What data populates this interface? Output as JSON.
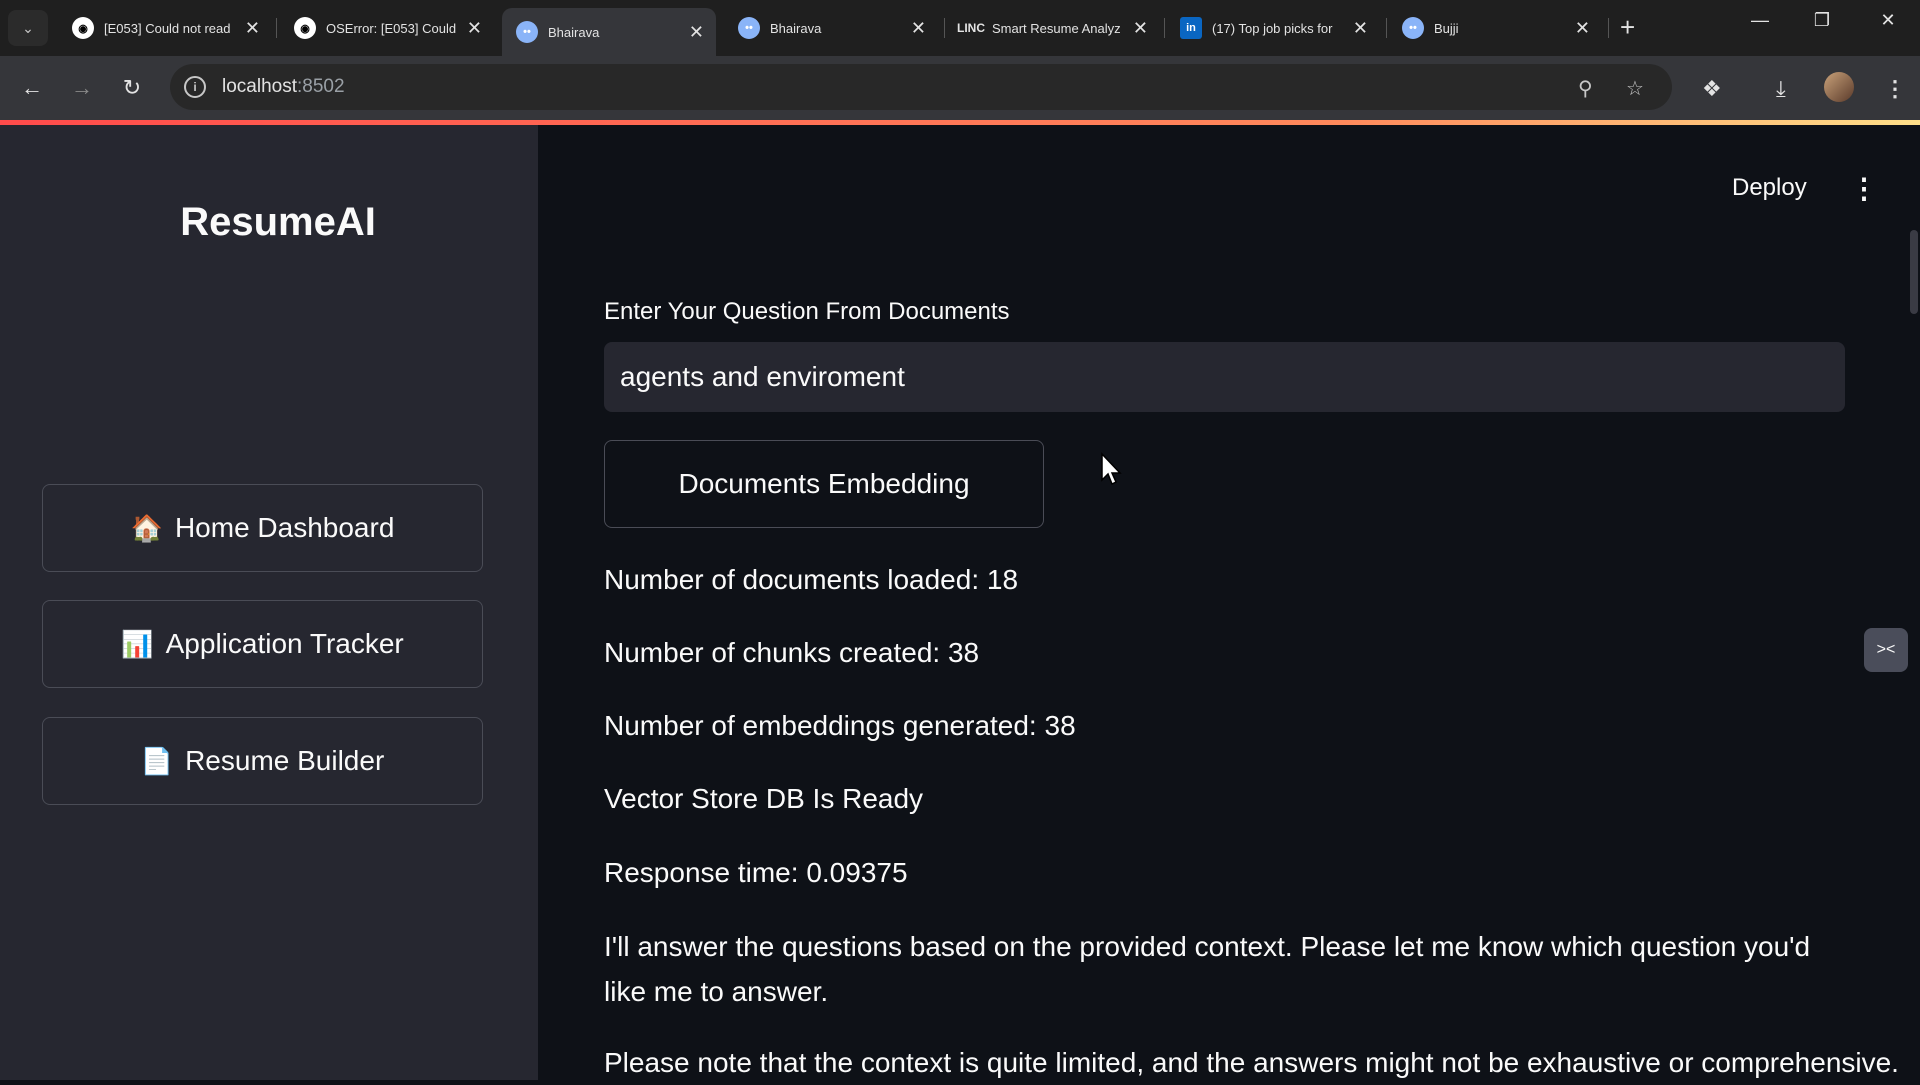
{
  "browser": {
    "tabs": [
      {
        "title": "[E053] Could not read",
        "icon": "github-icon"
      },
      {
        "title": "OSError: [E053] Could",
        "icon": "github-icon"
      },
      {
        "title": "Bhairava",
        "icon": "chat-icon",
        "active": true
      },
      {
        "title": "Bhairava",
        "icon": "chat-icon"
      },
      {
        "title": "Smart Resume Analyz",
        "icon": "linc-icon"
      },
      {
        "title": "(17) Top job picks for",
        "icon": "linkedin-icon"
      },
      {
        "title": "Bujji",
        "icon": "chat-icon"
      }
    ],
    "address": {
      "host": "localhost",
      "port": ":8502"
    }
  },
  "sidebar": {
    "brand": "ResumeAI",
    "items": [
      {
        "emoji": "🏠",
        "label": "Home Dashboard"
      },
      {
        "emoji": "📊",
        "label": "Application Tracker"
      },
      {
        "emoji": "📄",
        "label": "Resume Builder"
      }
    ]
  },
  "header": {
    "deploy_label": "Deploy"
  },
  "main": {
    "question_label": "Enter Your Question From Documents",
    "question_value": "agents and enviroment",
    "embed_button": "Documents Embedding",
    "stats": [
      "Number of documents loaded: 18",
      "Number of chunks created: 38",
      "Number of embeddings generated: 38",
      "Vector Store DB Is Ready",
      "Response time: 0.09375"
    ],
    "answer_1": "I'll answer the questions based on the provided context. Please let me know which question you'd like me to answer.",
    "answer_2": "Please note that the context is quite limited, and the answers might not be exhaustive or comprehensive."
  },
  "colors": {
    "background": "#0e1117",
    "sidebar": "#262730",
    "accent": "#ff4b4b"
  }
}
